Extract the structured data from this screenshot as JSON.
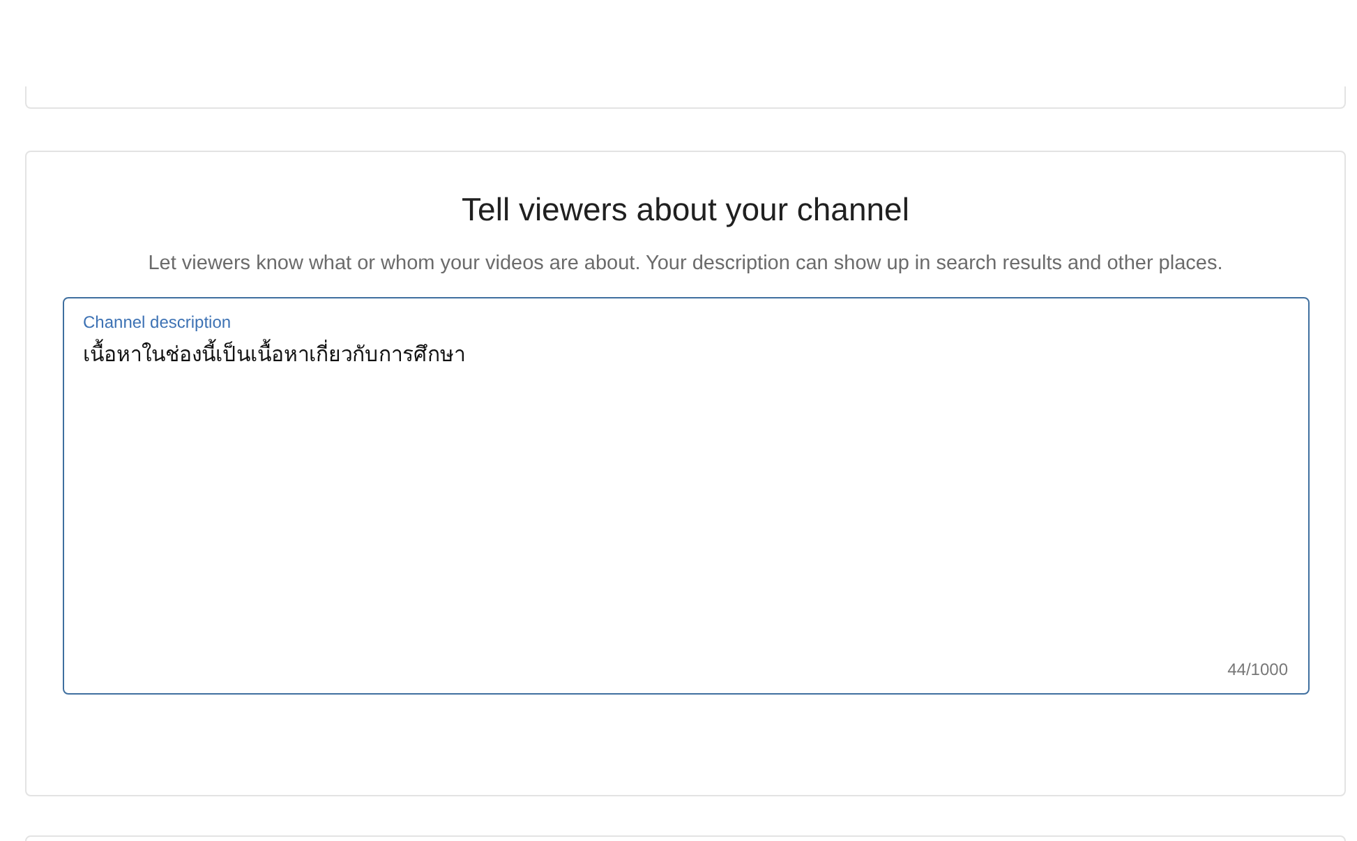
{
  "section": {
    "title": "Tell viewers about your channel",
    "subtitle": "Let viewers know what or whom your videos are about. Your description can show up in search results and other places."
  },
  "description_field": {
    "label": "Channel description",
    "value": "เนื้อหาในช่องนี้เป็นเนื้อหาเกี่ยวกับการศึกษา",
    "counter": "44/1000",
    "focused": true
  }
}
